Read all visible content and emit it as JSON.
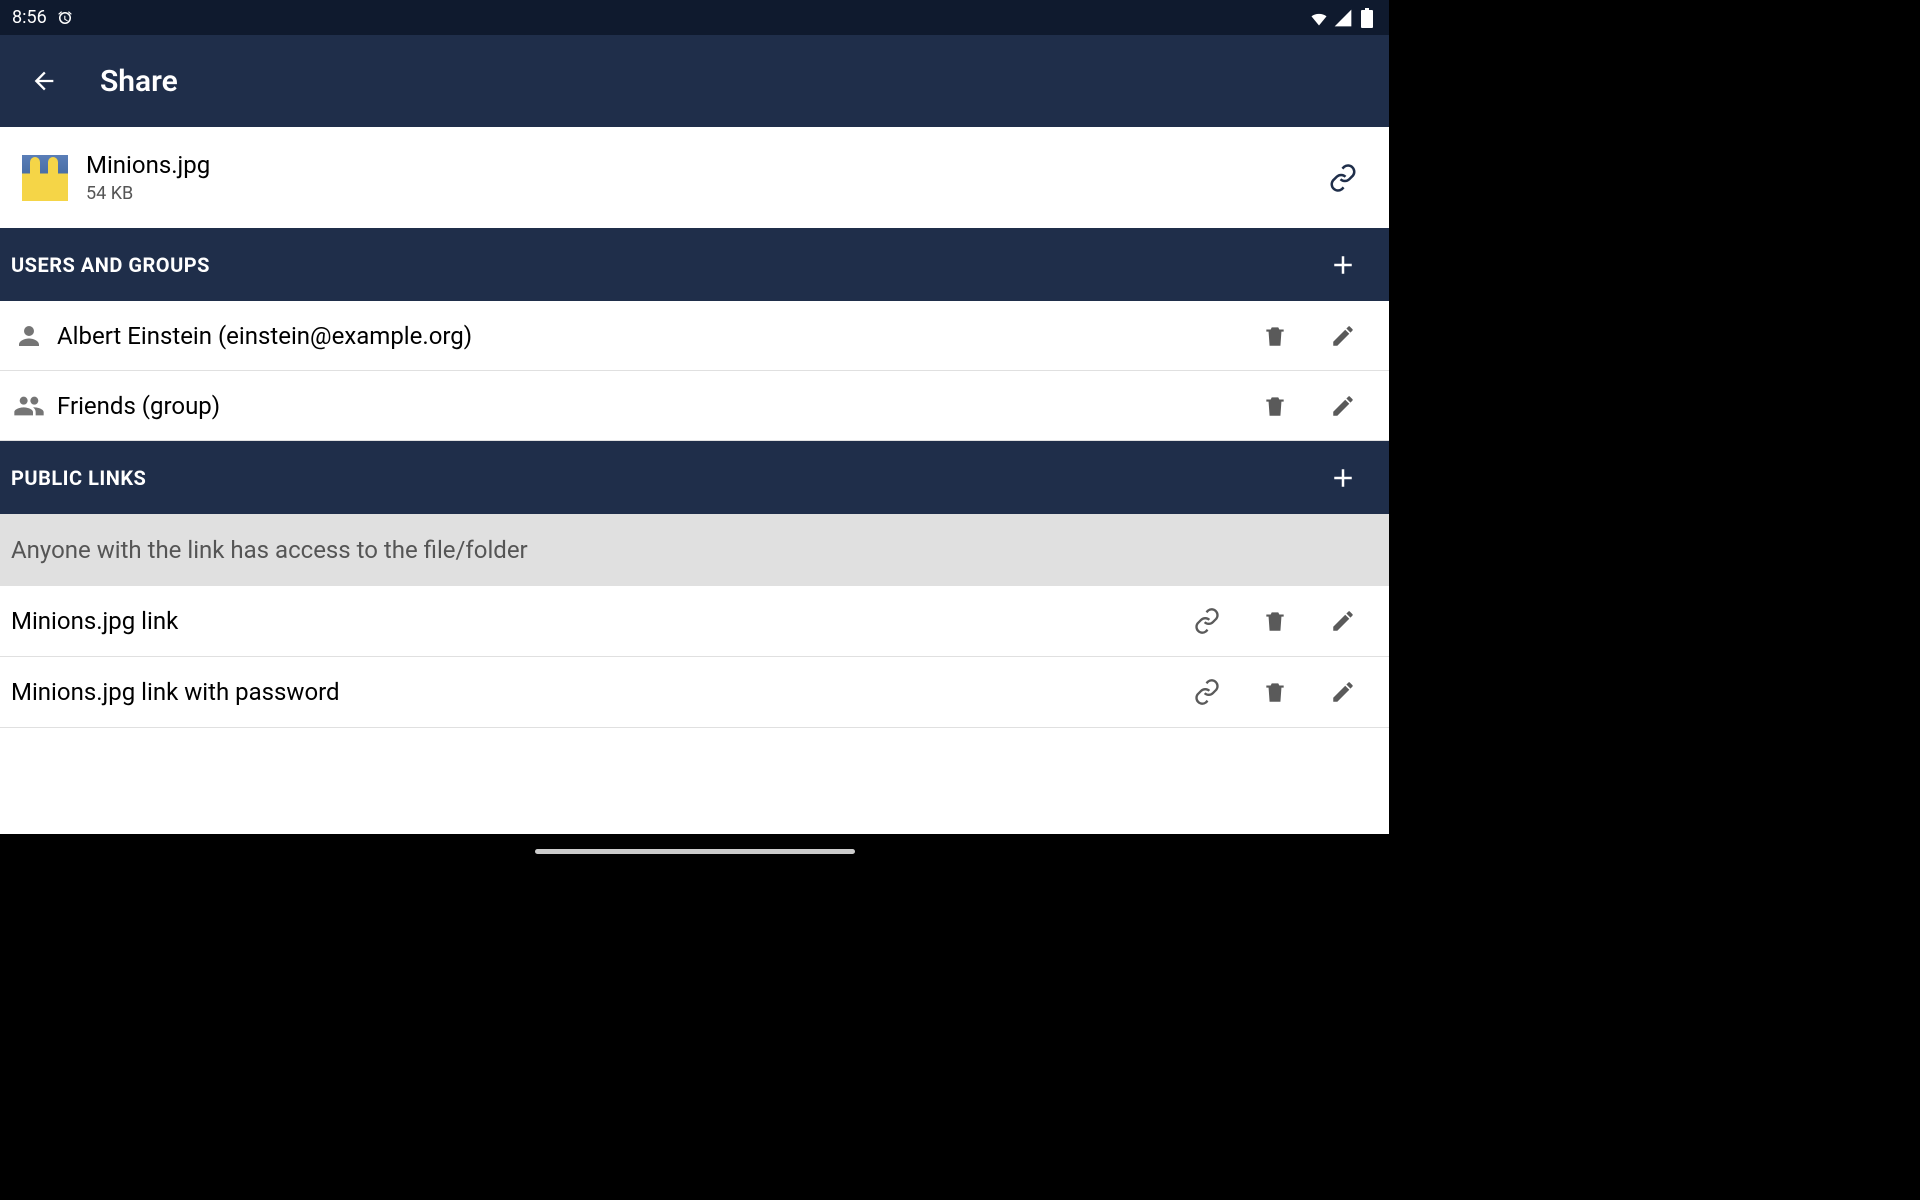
{
  "status_bar": {
    "time": "8:56",
    "alarm_icon": "alarm-icon"
  },
  "app_bar": {
    "title": "Share"
  },
  "file": {
    "name": "Minions.jpg",
    "size": "54 KB"
  },
  "sections": {
    "users_groups": {
      "title": "USERS AND GROUPS",
      "items": [
        {
          "type": "user",
          "label": "Albert Einstein (einstein@example.org)"
        },
        {
          "type": "group",
          "label": "Friends (group)"
        }
      ]
    },
    "public_links": {
      "title": "PUBLIC LINKS",
      "info": "Anyone with the link has access to the file/folder",
      "items": [
        {
          "label": "Minions.jpg link"
        },
        {
          "label": "Minions.jpg link with password"
        }
      ]
    }
  },
  "colors": {
    "status_bg": "#0f1a2e",
    "appbar_bg": "#1f2e4a",
    "icon_gray": "#5a5a5a",
    "banner_bg": "#e0e0e0"
  }
}
